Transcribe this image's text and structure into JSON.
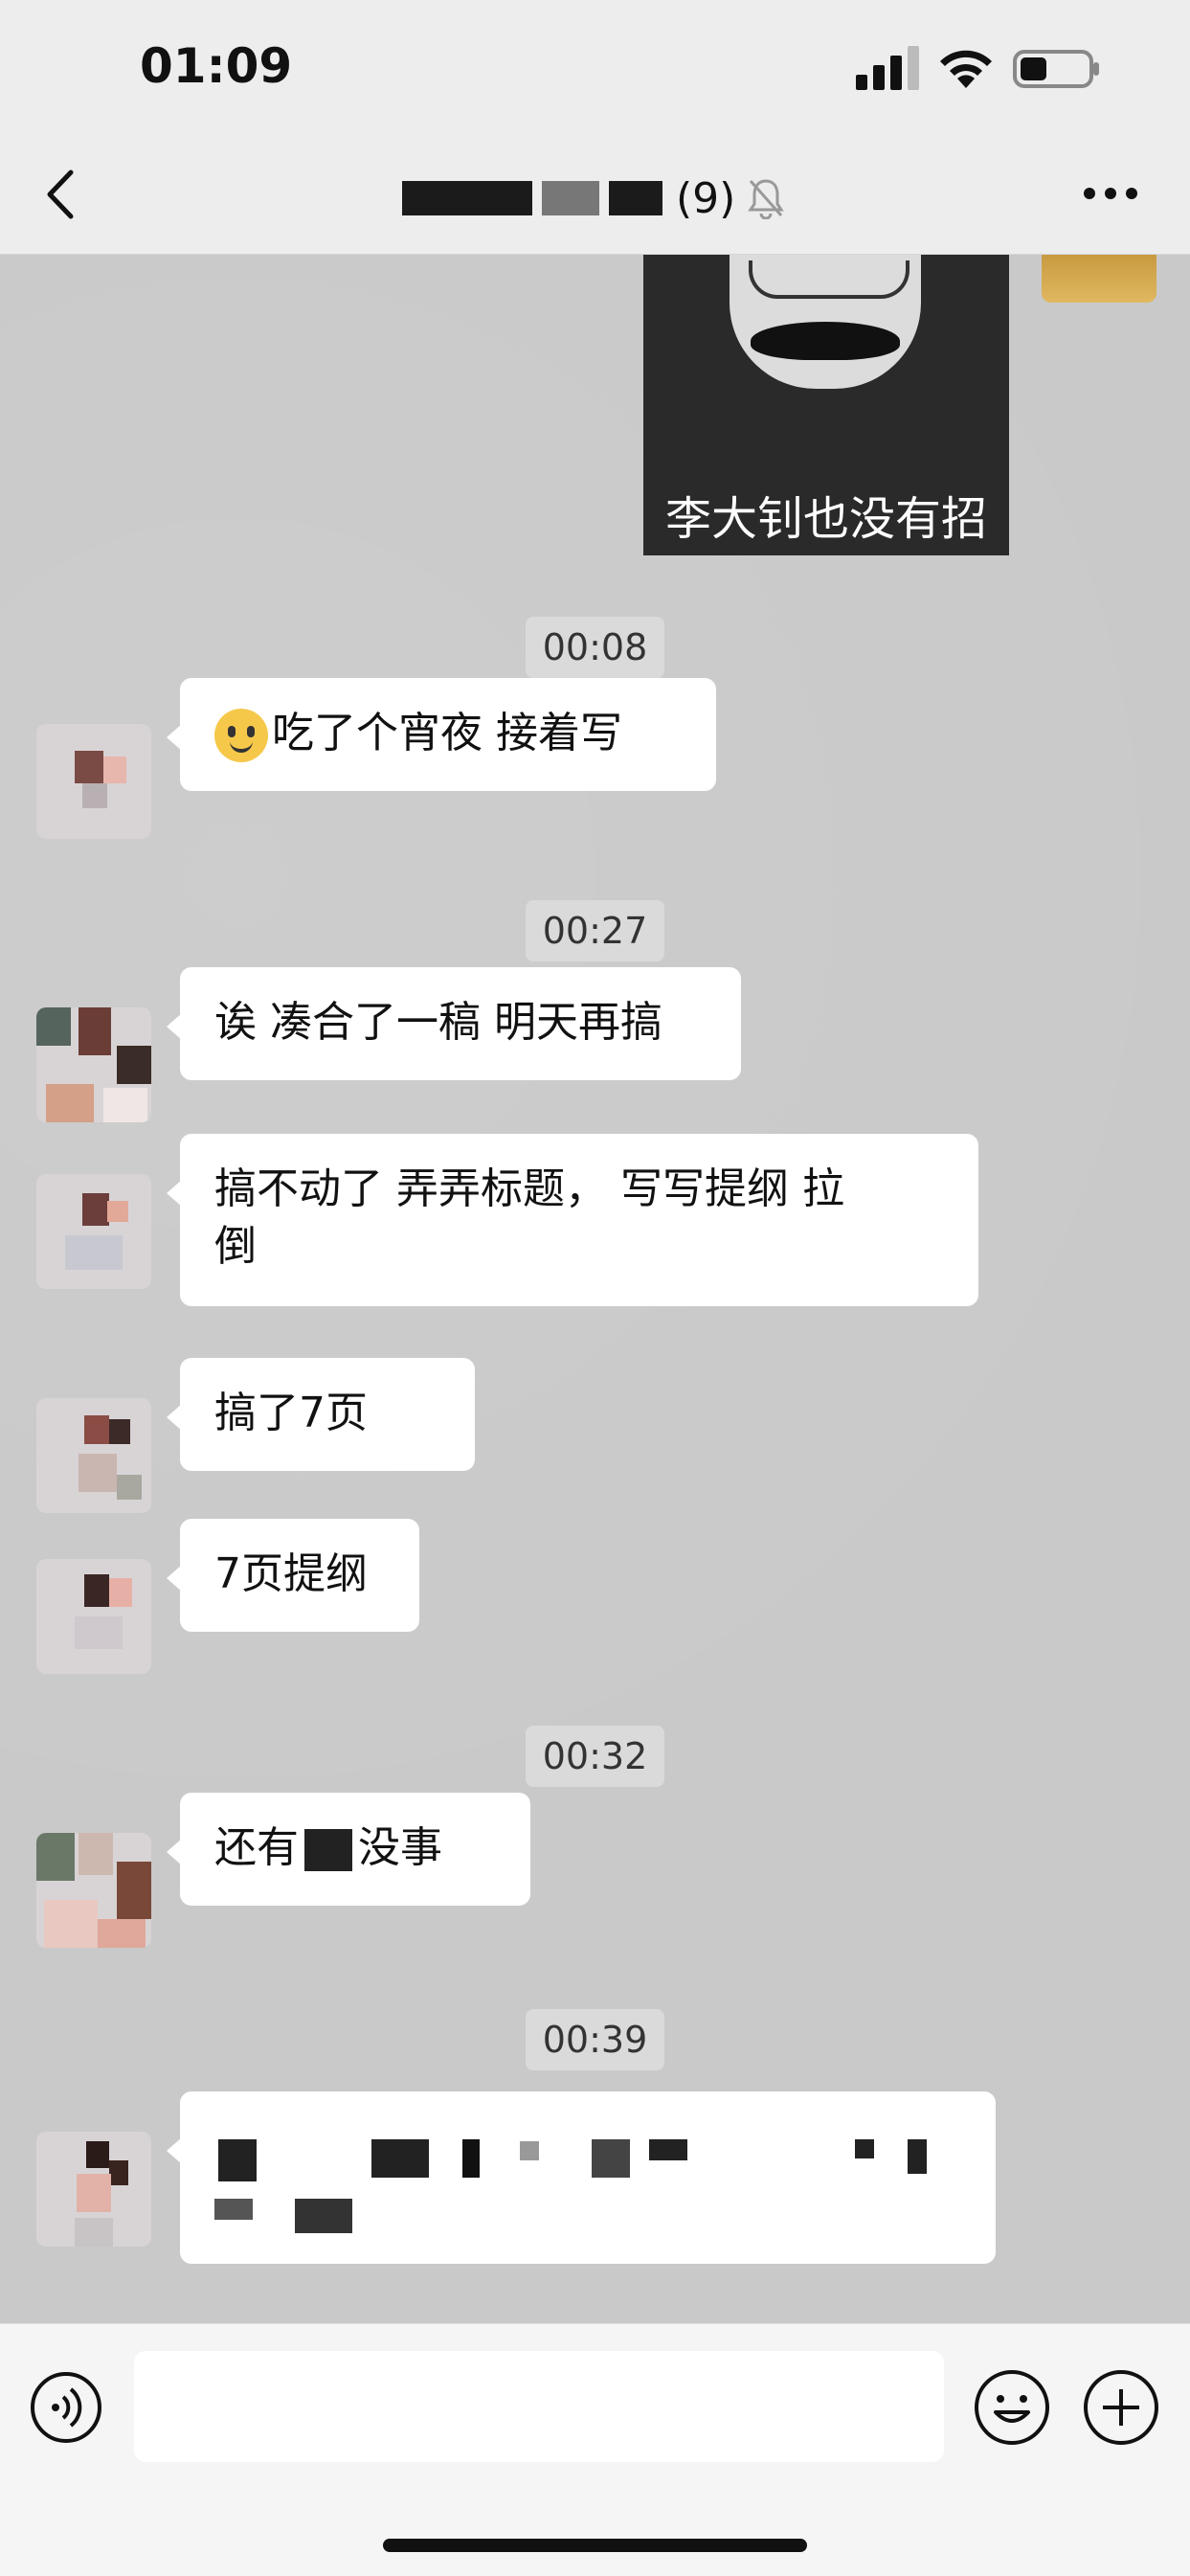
{
  "status_bar": {
    "time": "01:09",
    "battery_level": 0.4
  },
  "nav": {
    "member_count": "(9)"
  },
  "messages": [
    {
      "type": "sticker",
      "caption": "李大钊也没有招"
    },
    {
      "type": "timestamp",
      "text": "00:08"
    },
    {
      "type": "text",
      "text": "吃了个宵夜  接着写",
      "emoji": "smiling-face"
    },
    {
      "type": "timestamp",
      "text": "00:27"
    },
    {
      "type": "text",
      "text": "诶 凑合了一稿 明天再搞"
    },
    {
      "type": "text",
      "line1": "搞不动了   弄弄标题，   写写提纲 拉",
      "line2": "倒"
    },
    {
      "type": "text",
      "text": "搞了7页"
    },
    {
      "type": "text",
      "text": "7页提纲"
    },
    {
      "type": "timestamp",
      "text": "00:32"
    },
    {
      "type": "text",
      "prefix": "还有",
      "suffix": "没事"
    },
    {
      "type": "timestamp",
      "text": "00:39"
    },
    {
      "type": "text",
      "text": ""
    }
  ]
}
